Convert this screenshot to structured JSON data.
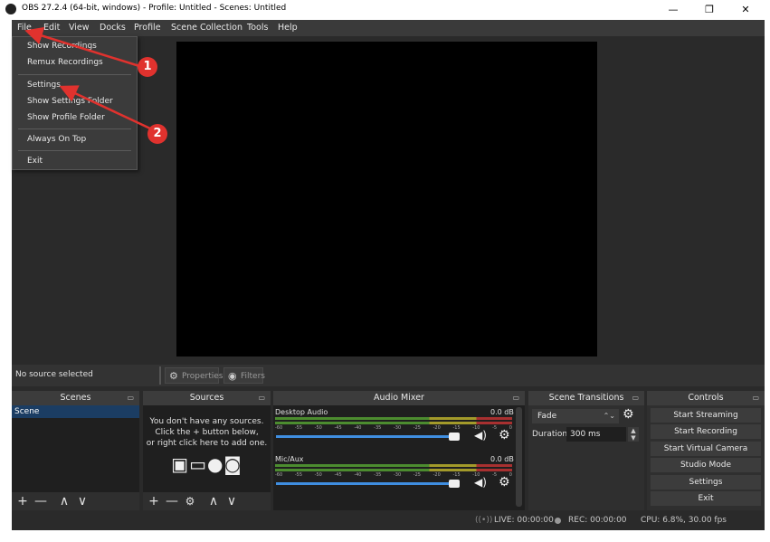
{
  "window": {
    "title": "OBS 27.2.4 (64-bit, windows) - Profile: Untitled - Scenes: Untitled",
    "minimize": "—",
    "maximize": "❐",
    "close": "✕"
  },
  "menubar": {
    "items": [
      "File",
      "Edit",
      "View",
      "Docks",
      "Profile",
      "Scene Collection",
      "Tools",
      "Help"
    ]
  },
  "file_menu": {
    "items": [
      "Show Recordings",
      "Remux Recordings",
      "Settings",
      "Show Settings Folder",
      "Show Profile Folder",
      "Always On Top",
      "Exit"
    ]
  },
  "annotations": {
    "one": "1",
    "two": "2"
  },
  "context_bar": {
    "no_source": "No source selected",
    "properties": "Properties",
    "filters": "Filters"
  },
  "scenes": {
    "title": "Scenes",
    "items": [
      "Scene"
    ]
  },
  "sources": {
    "title": "Sources",
    "empty_line1": "You don't have any sources.",
    "empty_line2": "Click the + button below,",
    "empty_line3": "or right click here to add one."
  },
  "audio_mixer": {
    "title": "Audio Mixer",
    "channels": [
      {
        "name": "Desktop Audio",
        "level": "0.0 dB",
        "volume": 0.92
      },
      {
        "name": "Mic/Aux",
        "level": "0.0 dB",
        "volume": 0.92
      }
    ],
    "scale": [
      "-60",
      "-55",
      "-50",
      "-45",
      "-40",
      "-35",
      "-30",
      "-25",
      "-20",
      "-15",
      "-10",
      "-5",
      "0"
    ]
  },
  "transitions": {
    "title": "Scene Transitions",
    "selected": "Fade",
    "duration_label": "Duration",
    "duration_value": "300 ms"
  },
  "controls": {
    "title": "Controls",
    "buttons": [
      "Start Streaming",
      "Start Recording",
      "Start Virtual Camera",
      "Studio Mode",
      "Settings",
      "Exit"
    ]
  },
  "status": {
    "live": "LIVE: 00:00:00",
    "rec": "REC: 00:00:00",
    "cpu": "CPU: 6.8%, 30.00 fps"
  },
  "colors": {
    "accent_blue": "#3f8ee0",
    "annotation_red": "#e0322e",
    "scene_selected": "#1b3d63"
  }
}
